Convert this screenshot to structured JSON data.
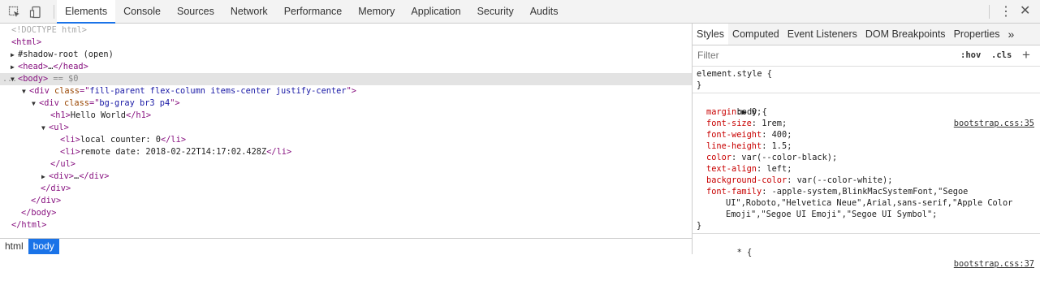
{
  "toolbar": {
    "tabs": [
      "Elements",
      "Console",
      "Sources",
      "Network",
      "Performance",
      "Memory",
      "Application",
      "Security",
      "Audits"
    ],
    "active_tab": "Elements"
  },
  "dom": {
    "lines": [
      {
        "indent": 14,
        "tri": "",
        "parts": [
          [
            "doctype",
            "<!DOCTYPE html>"
          ]
        ]
      },
      {
        "indent": 14,
        "tri": "",
        "parts": [
          [
            "tag",
            "<html>"
          ]
        ]
      },
      {
        "indent": 14,
        "tri": "▶",
        "parts": [
          [
            "txt",
            "#shadow-root (open)"
          ]
        ]
      },
      {
        "indent": 14,
        "tri": "▶",
        "parts": [
          [
            "tag",
            "<head>"
          ],
          [
            "txt",
            "…"
          ],
          [
            "tag",
            "</head>"
          ]
        ]
      },
      {
        "indent": 14,
        "tri": "▼",
        "parts": [
          [
            "tag",
            "<body>"
          ],
          [
            "eq",
            " == $0"
          ]
        ],
        "selected": true
      },
      {
        "indent": 28,
        "tri": "▼",
        "parts": [
          [
            "tag",
            "<div "
          ],
          [
            "attr",
            "class"
          ],
          [
            "tag",
            "=\""
          ],
          [
            "val",
            "fill-parent flex-column items-center justify-center"
          ],
          [
            "tag",
            "\">"
          ]
        ]
      },
      {
        "indent": 40,
        "tri": "▼",
        "parts": [
          [
            "tag",
            "<div "
          ],
          [
            "attr",
            "class"
          ],
          [
            "tag",
            "=\""
          ],
          [
            "val",
            "bg-gray br3 p4"
          ],
          [
            "tag",
            "\">"
          ]
        ]
      },
      {
        "indent": 62,
        "tri": "",
        "parts": [
          [
            "tag",
            "<h1>"
          ],
          [
            "txt",
            "Hello World"
          ],
          [
            "tag",
            "</h1>"
          ]
        ]
      },
      {
        "indent": 52,
        "tri": "▼",
        "parts": [
          [
            "tag",
            "<ul>"
          ]
        ]
      },
      {
        "indent": 74,
        "tri": "",
        "parts": [
          [
            "tag",
            "<li>"
          ],
          [
            "txt",
            "local counter: 0"
          ],
          [
            "tag",
            "</li>"
          ]
        ]
      },
      {
        "indent": 74,
        "tri": "",
        "parts": [
          [
            "tag",
            "<li>"
          ],
          [
            "txt",
            "remote date: 2018-02-22T14:17:02.428Z"
          ],
          [
            "tag",
            "</li>"
          ]
        ]
      },
      {
        "indent": 62,
        "tri": "",
        "parts": [
          [
            "tag",
            "</ul>"
          ]
        ]
      },
      {
        "indent": 52,
        "tri": "▶",
        "parts": [
          [
            "tag",
            "<div>"
          ],
          [
            "txt",
            "…"
          ],
          [
            "tag",
            "</div>"
          ]
        ]
      },
      {
        "indent": 50,
        "tri": "",
        "parts": [
          [
            "tag",
            "</div>"
          ]
        ]
      },
      {
        "indent": 38,
        "tri": "",
        "parts": [
          [
            "tag",
            "</div>"
          ]
        ]
      },
      {
        "indent": 26,
        "tri": "",
        "parts": [
          [
            "tag",
            "</body>"
          ]
        ]
      },
      {
        "indent": 14,
        "tri": "",
        "parts": [
          [
            "tag",
            "</html>"
          ]
        ]
      }
    ],
    "selected_dots": "..."
  },
  "breadcrumbs": [
    "html",
    "body"
  ],
  "styles_panel": {
    "tabs": [
      "Styles",
      "Computed",
      "Event Listeners",
      "DOM Breakpoints",
      "Properties"
    ],
    "more": "»",
    "filter_placeholder": "Filter",
    "hov": ":hov",
    "cls": ".cls",
    "plus": "+",
    "element_style": "element.style {",
    "close_brace": "}",
    "body_selector": "body {",
    "body_source": "bootstrap.css:35",
    "declarations": [
      {
        "prop": "margin",
        "value": "▶ 0;"
      },
      {
        "prop": "font-size",
        "value": " 1rem;"
      },
      {
        "prop": "font-weight",
        "value": " 400;"
      },
      {
        "prop": "line-height",
        "value": " 1.5;"
      },
      {
        "prop": "color",
        "value": " var(--color-black);"
      },
      {
        "prop": "text-align",
        "value": " left;"
      },
      {
        "prop": "background-color",
        "value": " var(--color-white);"
      },
      {
        "prop": "font-family",
        "value": " -apple-system,BlinkMacSystemFont,\"Segoe"
      }
    ],
    "font_family_wrap": [
      "UI\",Roboto,\"Helvetica Neue\",Arial,sans-serif,\"Apple Color",
      "Emoji\",\"Segoe UI Emoji\",\"Segoe UI Symbol\";"
    ],
    "star_selector": "* {",
    "star_source": "bootstrap.css:37"
  }
}
